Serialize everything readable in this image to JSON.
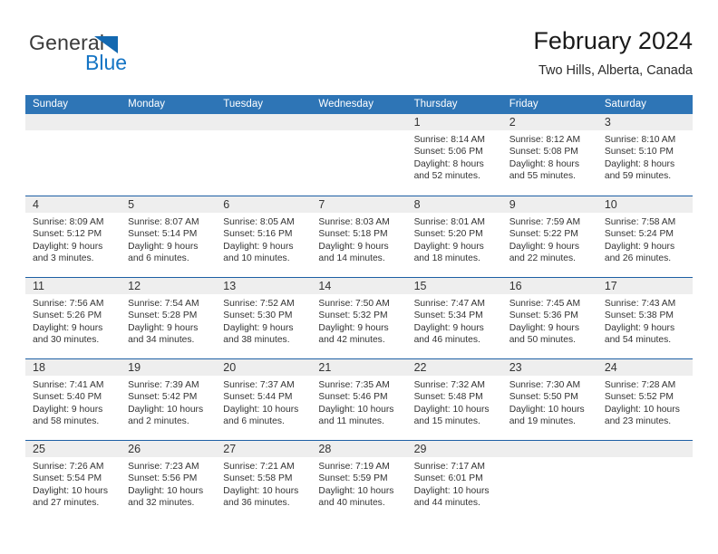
{
  "brand": {
    "name_part1": "General",
    "name_part2": "Blue",
    "triangle_color": "#1368b0",
    "blue_text_color": "#1474c4"
  },
  "header": {
    "title": "February 2024",
    "subtitle": "Two Hills, Alberta, Canada"
  },
  "theme": {
    "header_blue": "#2e75b6",
    "row_divider_blue": "#1d5fa4",
    "daynum_band_gray": "#eeeeee"
  },
  "weekdays": [
    "Sunday",
    "Monday",
    "Tuesday",
    "Wednesday",
    "Thursday",
    "Friday",
    "Saturday"
  ],
  "weeks": [
    [
      {
        "day": "",
        "sunrise": "",
        "sunset": "",
        "daylight1": "",
        "daylight2": ""
      },
      {
        "day": "",
        "sunrise": "",
        "sunset": "",
        "daylight1": "",
        "daylight2": ""
      },
      {
        "day": "",
        "sunrise": "",
        "sunset": "",
        "daylight1": "",
        "daylight2": ""
      },
      {
        "day": "",
        "sunrise": "",
        "sunset": "",
        "daylight1": "",
        "daylight2": ""
      },
      {
        "day": "1",
        "sunrise": "Sunrise: 8:14 AM",
        "sunset": "Sunset: 5:06 PM",
        "daylight1": "Daylight: 8 hours",
        "daylight2": "and 52 minutes."
      },
      {
        "day": "2",
        "sunrise": "Sunrise: 8:12 AM",
        "sunset": "Sunset: 5:08 PM",
        "daylight1": "Daylight: 8 hours",
        "daylight2": "and 55 minutes."
      },
      {
        "day": "3",
        "sunrise": "Sunrise: 8:10 AM",
        "sunset": "Sunset: 5:10 PM",
        "daylight1": "Daylight: 8 hours",
        "daylight2": "and 59 minutes."
      }
    ],
    [
      {
        "day": "4",
        "sunrise": "Sunrise: 8:09 AM",
        "sunset": "Sunset: 5:12 PM",
        "daylight1": "Daylight: 9 hours",
        "daylight2": "and 3 minutes."
      },
      {
        "day": "5",
        "sunrise": "Sunrise: 8:07 AM",
        "sunset": "Sunset: 5:14 PM",
        "daylight1": "Daylight: 9 hours",
        "daylight2": "and 6 minutes."
      },
      {
        "day": "6",
        "sunrise": "Sunrise: 8:05 AM",
        "sunset": "Sunset: 5:16 PM",
        "daylight1": "Daylight: 9 hours",
        "daylight2": "and 10 minutes."
      },
      {
        "day": "7",
        "sunrise": "Sunrise: 8:03 AM",
        "sunset": "Sunset: 5:18 PM",
        "daylight1": "Daylight: 9 hours",
        "daylight2": "and 14 minutes."
      },
      {
        "day": "8",
        "sunrise": "Sunrise: 8:01 AM",
        "sunset": "Sunset: 5:20 PM",
        "daylight1": "Daylight: 9 hours",
        "daylight2": "and 18 minutes."
      },
      {
        "day": "9",
        "sunrise": "Sunrise: 7:59 AM",
        "sunset": "Sunset: 5:22 PM",
        "daylight1": "Daylight: 9 hours",
        "daylight2": "and 22 minutes."
      },
      {
        "day": "10",
        "sunrise": "Sunrise: 7:58 AM",
        "sunset": "Sunset: 5:24 PM",
        "daylight1": "Daylight: 9 hours",
        "daylight2": "and 26 minutes."
      }
    ],
    [
      {
        "day": "11",
        "sunrise": "Sunrise: 7:56 AM",
        "sunset": "Sunset: 5:26 PM",
        "daylight1": "Daylight: 9 hours",
        "daylight2": "and 30 minutes."
      },
      {
        "day": "12",
        "sunrise": "Sunrise: 7:54 AM",
        "sunset": "Sunset: 5:28 PM",
        "daylight1": "Daylight: 9 hours",
        "daylight2": "and 34 minutes."
      },
      {
        "day": "13",
        "sunrise": "Sunrise: 7:52 AM",
        "sunset": "Sunset: 5:30 PM",
        "daylight1": "Daylight: 9 hours",
        "daylight2": "and 38 minutes."
      },
      {
        "day": "14",
        "sunrise": "Sunrise: 7:50 AM",
        "sunset": "Sunset: 5:32 PM",
        "daylight1": "Daylight: 9 hours",
        "daylight2": "and 42 minutes."
      },
      {
        "day": "15",
        "sunrise": "Sunrise: 7:47 AM",
        "sunset": "Sunset: 5:34 PM",
        "daylight1": "Daylight: 9 hours",
        "daylight2": "and 46 minutes."
      },
      {
        "day": "16",
        "sunrise": "Sunrise: 7:45 AM",
        "sunset": "Sunset: 5:36 PM",
        "daylight1": "Daylight: 9 hours",
        "daylight2": "and 50 minutes."
      },
      {
        "day": "17",
        "sunrise": "Sunrise: 7:43 AM",
        "sunset": "Sunset: 5:38 PM",
        "daylight1": "Daylight: 9 hours",
        "daylight2": "and 54 minutes."
      }
    ],
    [
      {
        "day": "18",
        "sunrise": "Sunrise: 7:41 AM",
        "sunset": "Sunset: 5:40 PM",
        "daylight1": "Daylight: 9 hours",
        "daylight2": "and 58 minutes."
      },
      {
        "day": "19",
        "sunrise": "Sunrise: 7:39 AM",
        "sunset": "Sunset: 5:42 PM",
        "daylight1": "Daylight: 10 hours",
        "daylight2": "and 2 minutes."
      },
      {
        "day": "20",
        "sunrise": "Sunrise: 7:37 AM",
        "sunset": "Sunset: 5:44 PM",
        "daylight1": "Daylight: 10 hours",
        "daylight2": "and 6 minutes."
      },
      {
        "day": "21",
        "sunrise": "Sunrise: 7:35 AM",
        "sunset": "Sunset: 5:46 PM",
        "daylight1": "Daylight: 10 hours",
        "daylight2": "and 11 minutes."
      },
      {
        "day": "22",
        "sunrise": "Sunrise: 7:32 AM",
        "sunset": "Sunset: 5:48 PM",
        "daylight1": "Daylight: 10 hours",
        "daylight2": "and 15 minutes."
      },
      {
        "day": "23",
        "sunrise": "Sunrise: 7:30 AM",
        "sunset": "Sunset: 5:50 PM",
        "daylight1": "Daylight: 10 hours",
        "daylight2": "and 19 minutes."
      },
      {
        "day": "24",
        "sunrise": "Sunrise: 7:28 AM",
        "sunset": "Sunset: 5:52 PM",
        "daylight1": "Daylight: 10 hours",
        "daylight2": "and 23 minutes."
      }
    ],
    [
      {
        "day": "25",
        "sunrise": "Sunrise: 7:26 AM",
        "sunset": "Sunset: 5:54 PM",
        "daylight1": "Daylight: 10 hours",
        "daylight2": "and 27 minutes."
      },
      {
        "day": "26",
        "sunrise": "Sunrise: 7:23 AM",
        "sunset": "Sunset: 5:56 PM",
        "daylight1": "Daylight: 10 hours",
        "daylight2": "and 32 minutes."
      },
      {
        "day": "27",
        "sunrise": "Sunrise: 7:21 AM",
        "sunset": "Sunset: 5:58 PM",
        "daylight1": "Daylight: 10 hours",
        "daylight2": "and 36 minutes."
      },
      {
        "day": "28",
        "sunrise": "Sunrise: 7:19 AM",
        "sunset": "Sunset: 5:59 PM",
        "daylight1": "Daylight: 10 hours",
        "daylight2": "and 40 minutes."
      },
      {
        "day": "29",
        "sunrise": "Sunrise: 7:17 AM",
        "sunset": "Sunset: 6:01 PM",
        "daylight1": "Daylight: 10 hours",
        "daylight2": "and 44 minutes."
      },
      {
        "day": "",
        "sunrise": "",
        "sunset": "",
        "daylight1": "",
        "daylight2": ""
      },
      {
        "day": "",
        "sunrise": "",
        "sunset": "",
        "daylight1": "",
        "daylight2": ""
      }
    ]
  ]
}
